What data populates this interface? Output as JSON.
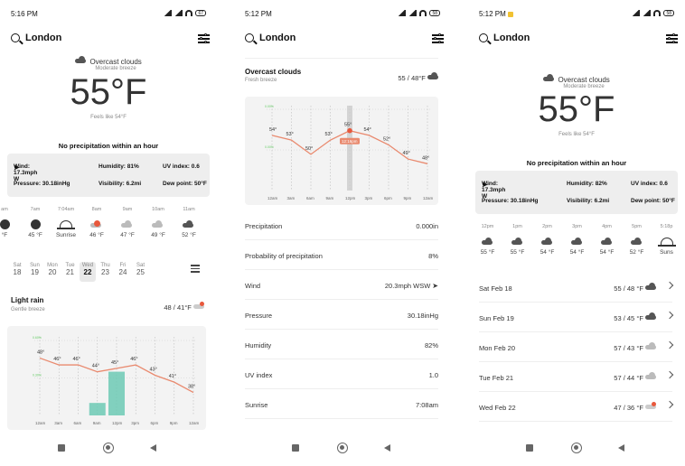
{
  "status": {
    "s1_time": "5:16 PM",
    "s2_time": "5:12 PM",
    "s3_time": "5:12 PM",
    "s1_batt": "67",
    "s2_batt": "58",
    "s3_batt": "58"
  },
  "city": "London",
  "current": {
    "condition": "Overcast clouds",
    "wind_desc": "Moderate breeze",
    "temp": "55°F",
    "feels": "Feels like 54°F",
    "precip_note": "No precipitation within an hour"
  },
  "info": {
    "wind": "Wind: 17.3mph W",
    "humidity": "Humidity: 81%",
    "uv": "UV index: 0.6",
    "pressure": "Pressure: 30.18inHg",
    "visibility": "Visibility: 6.2mi",
    "dew": "Dew point: 50°F"
  },
  "info3": {
    "wind": "Wind: 17.3mph W",
    "humidity": "Humidity: 82%",
    "uv": "UV index: 0.6",
    "pressure": "Pressure: 30.18inHg",
    "visibility": "Visibility: 6.2mi",
    "dew": "Dew point: 50°F"
  },
  "hourly1": [
    {
      "time": "am",
      "icon": "moon-icon",
      "temp": "°F"
    },
    {
      "time": "7am",
      "icon": "moon-icon",
      "temp": "45 °F"
    },
    {
      "time": "7:04am",
      "icon": "sunrise-icon",
      "temp": "Sunrise"
    },
    {
      "time": "8am",
      "icon": "cloud-sun-icon",
      "temp": "46 °F"
    },
    {
      "time": "9am",
      "icon": "cloud-icon",
      "temp": "47 °F"
    },
    {
      "time": "10am",
      "icon": "cloud-icon",
      "temp": "49 °F"
    },
    {
      "time": "11am",
      "icon": "cloud-dark-icon",
      "temp": "52 °F"
    }
  ],
  "days": [
    {
      "d": "Sat",
      "n": "18"
    },
    {
      "d": "Sun",
      "n": "19"
    },
    {
      "d": "Mon",
      "n": "20"
    },
    {
      "d": "Tue",
      "n": "21"
    },
    {
      "d": "Wed",
      "n": "22"
    },
    {
      "d": "Thu",
      "n": "23"
    },
    {
      "d": "Fri",
      "n": "24"
    },
    {
      "d": "Sat",
      "n": "25"
    }
  ],
  "day1": {
    "condition": "Light rain",
    "wind": "Gentle breeze",
    "temps": "48 / 41°F"
  },
  "chart1": {
    "times": [
      "12am",
      "3am",
      "6am",
      "9am",
      "12pm",
      "3pm",
      "6pm",
      "9pm",
      "12am"
    ],
    "temps": [
      "48°",
      "46°",
      "46°",
      "44°",
      "45°",
      "46°",
      "43°",
      "41°",
      "38°"
    ],
    "temp_vals": [
      48,
      46,
      46,
      44,
      45,
      46,
      43,
      41,
      38
    ],
    "precip": [
      0,
      0,
      0,
      0.1,
      0.35,
      0,
      0,
      0,
      0
    ],
    "side_top": "0.60%",
    "side_bottom": "0.30%"
  },
  "s2": {
    "condition": "Overcast clouds",
    "wind_desc": "Fresh breeze",
    "temps": "55 / 48°F",
    "chart": {
      "times": [
        "12am",
        "3am",
        "6am",
        "9am",
        "12pm",
        "3pm",
        "6pm",
        "9pm",
        "12am"
      ],
      "temps": [
        "54°",
        "53°",
        "50°",
        "53°",
        "55°",
        "54°",
        "52°",
        "49°",
        "48°"
      ],
      "temp_vals": [
        54,
        53,
        50,
        53,
        55,
        54,
        52,
        49,
        48
      ],
      "now": "12:16pm",
      "side_top": "0.00%",
      "side_bottom": "0.00%"
    },
    "rows": [
      {
        "label": "Precipitation",
        "value": "0.000in"
      },
      {
        "label": "Probability of precipitation",
        "value": "8%"
      },
      {
        "label": "Wind",
        "value": "20.3mph WSW"
      },
      {
        "label": "Pressure",
        "value": "30.18inHg"
      },
      {
        "label": "Humidity",
        "value": "82%"
      },
      {
        "label": "UV index",
        "value": "1.0"
      },
      {
        "label": "Sunrise",
        "value": "7:08am"
      }
    ]
  },
  "hourly3": [
    {
      "time": "12pm",
      "temp": "55 °F"
    },
    {
      "time": "1pm",
      "temp": "55 °F"
    },
    {
      "time": "2pm",
      "temp": "54 °F"
    },
    {
      "time": "3pm",
      "temp": "54 °F"
    },
    {
      "time": "4pm",
      "temp": "54 °F"
    },
    {
      "time": "5pm",
      "temp": "52 °F"
    },
    {
      "time": "5:18p",
      "temp": "Suns"
    }
  ],
  "daily3": [
    {
      "day": "Sat Feb 18",
      "temps": "55 / 48 °F",
      "icon": "cloud-dark-icon"
    },
    {
      "day": "Sun Feb 19",
      "temps": "53 / 45 °F",
      "icon": "cloud-dark-icon"
    },
    {
      "day": "Mon Feb 20",
      "temps": "57 / 43 °F",
      "icon": "cloud-icon"
    },
    {
      "day": "Tue Feb 21",
      "temps": "57 / 44 °F",
      "icon": "cloud-icon"
    },
    {
      "day": "Wed Feb 22",
      "temps": "47 / 36 °F",
      "icon": "cloud-rain-icon"
    }
  ]
}
